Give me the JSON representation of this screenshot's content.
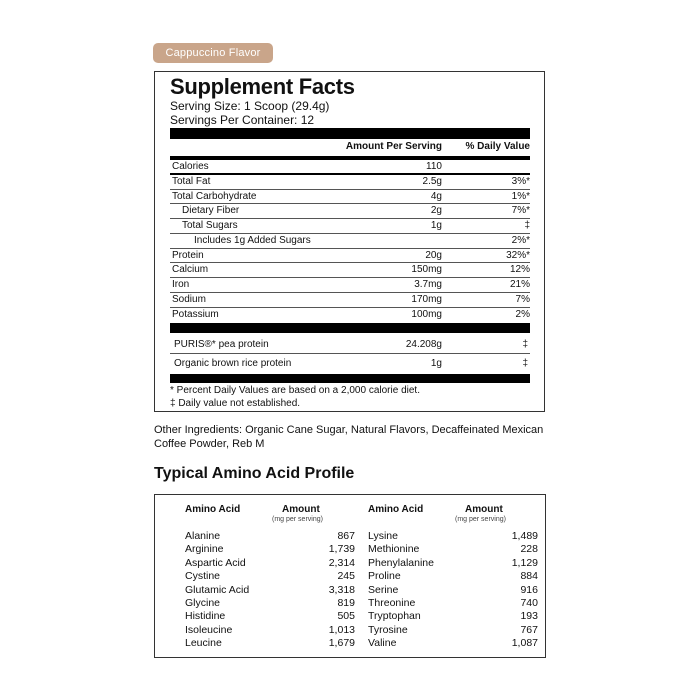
{
  "flavor_badge": "Cappuccino Flavor",
  "supplement_facts": {
    "title": "Supplement Facts",
    "serving_size": "Serving Size: 1 Scoop (29.4g)",
    "servings_per_container": "Servings Per Container: 12",
    "col_amount": "Amount Per Serving",
    "col_dv": "% Daily Value",
    "rows": [
      {
        "name": "Calories",
        "amount": "110",
        "dv": ""
      },
      {
        "name": "Total Fat",
        "amount": "2.5g",
        "dv": "3%*"
      },
      {
        "name": "Total Carbohydrate",
        "amount": "4g",
        "dv": "1%*"
      },
      {
        "name": "Dietary Fiber",
        "amount": "2g",
        "dv": "7%*"
      },
      {
        "name": "Total Sugars",
        "amount": "1g",
        "dv": "‡"
      },
      {
        "name": "Includes 1g Added Sugars",
        "amount": "",
        "dv": "2%*"
      },
      {
        "name": "Protein",
        "amount": "20g",
        "dv": "32%*"
      },
      {
        "name": "Calcium",
        "amount": "150mg",
        "dv": "12%"
      },
      {
        "name": "Iron",
        "amount": "3.7mg",
        "dv": "21%"
      },
      {
        "name": "Sodium",
        "amount": "170mg",
        "dv": "7%"
      },
      {
        "name": "Potassium",
        "amount": "100mg",
        "dv": "2%"
      }
    ],
    "protein_rows": [
      {
        "name": "PURIS®* pea protein",
        "amount": "24.208g",
        "dv": "‡"
      },
      {
        "name": "Organic brown rice protein",
        "amount": "1g",
        "dv": "‡"
      }
    ],
    "footnote_1": "* Percent Daily Values are based on a 2,000 calorie diet.",
    "footnote_2": "‡ Daily value not established."
  },
  "other_ingredients": "Other Ingredients: Organic Cane Sugar, Natural Flavors, Decaffeinated Mexican Coffee Powder, Reb M",
  "amino_profile": {
    "title": "Typical Amino Acid Profile",
    "col_name": "Amino Acid",
    "col_amount": "Amount",
    "col_unit": "(mg per serving)",
    "left": [
      {
        "name": "Alanine",
        "value": "867"
      },
      {
        "name": "Arginine",
        "value": "1,739"
      },
      {
        "name": "Aspartic Acid",
        "value": "2,314"
      },
      {
        "name": "Cystine",
        "value": "245"
      },
      {
        "name": "Glutamic Acid",
        "value": "3,318"
      },
      {
        "name": "Glycine",
        "value": "819"
      },
      {
        "name": "Histidine",
        "value": "505"
      },
      {
        "name": "Isoleucine",
        "value": "1,013"
      },
      {
        "name": "Leucine",
        "value": "1,679"
      }
    ],
    "right": [
      {
        "name": "Lysine",
        "value": "1,489"
      },
      {
        "name": "Methionine",
        "value": "228"
      },
      {
        "name": "Phenylalanine",
        "value": "1,129"
      },
      {
        "name": "Proline",
        "value": "884"
      },
      {
        "name": "Serine",
        "value": "916"
      },
      {
        "name": "Threonine",
        "value": "740"
      },
      {
        "name": "Tryptophan",
        "value": "193"
      },
      {
        "name": "Tyrosine",
        "value": "767"
      },
      {
        "name": "Valine",
        "value": "1,087"
      }
    ]
  }
}
